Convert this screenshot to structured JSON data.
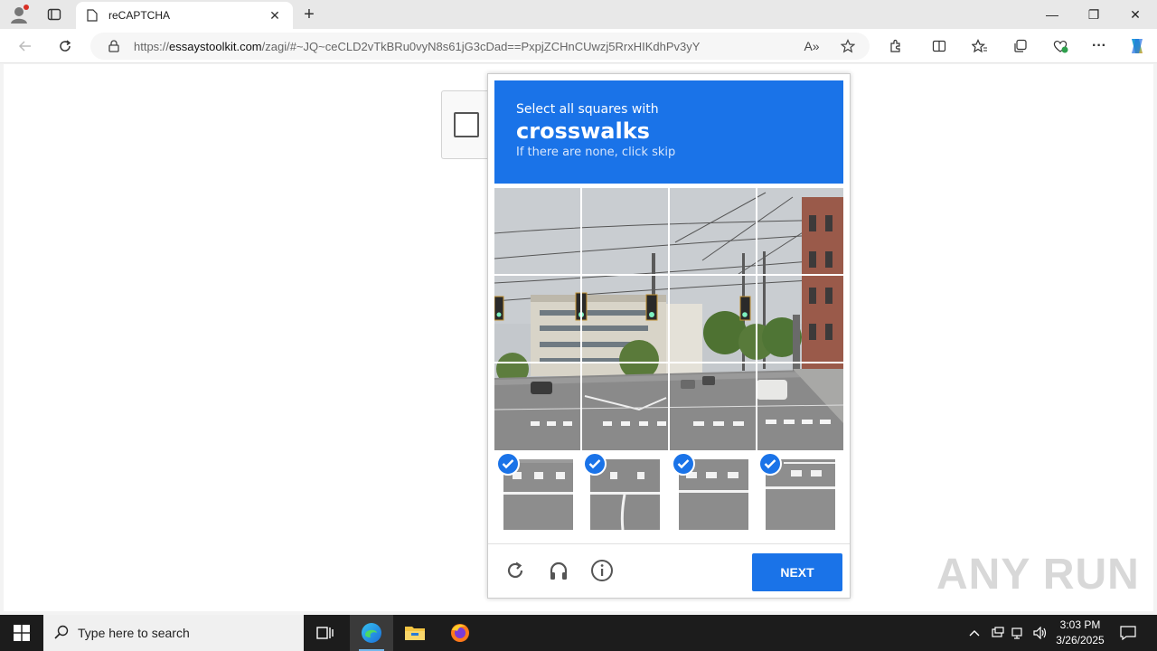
{
  "browser": {
    "tab": {
      "title": "reCAPTCHA",
      "close_label": "✕"
    },
    "new_tab_label": "+",
    "window_controls": {
      "minimize": "—",
      "restore": "❐",
      "close": "✕"
    },
    "address": {
      "scheme": "https://",
      "host": "essaystoolkit.com",
      "path": "/zagi/#~JQ~ceCLD2vTkBRu0vyN8s61jG3cDad==PxpjZCHnCUwzj5RrxHIKdhPv3yY"
    },
    "icons": [
      "back-icon",
      "refresh-icon",
      "lock-icon",
      "read-aloud-icon",
      "favorite-star-icon",
      "extensions-icon",
      "split-screen-icon",
      "favorites-icon",
      "collections-icon",
      "browser-essentials-icon",
      "more-icon",
      "copilot-icon"
    ]
  },
  "captcha": {
    "header": {
      "line1": "Select all squares with",
      "keyword": "crosswalks",
      "line3": "If there are none, click skip"
    },
    "selected_tiles": 4,
    "footer": {
      "next_label": "NEXT",
      "icons": [
        "reload-icon",
        "audio-headphones-icon",
        "info-icon"
      ]
    },
    "accent_color": "#1a73e8"
  },
  "watermark": {
    "text": "ANY RUN"
  },
  "taskbar": {
    "search_placeholder": "Type here to search",
    "time": "3:03 PM",
    "date": "3/26/2025",
    "apps": [
      "task-view-icon",
      "edge-icon",
      "file-explorer-icon",
      "firefox-icon"
    ]
  }
}
